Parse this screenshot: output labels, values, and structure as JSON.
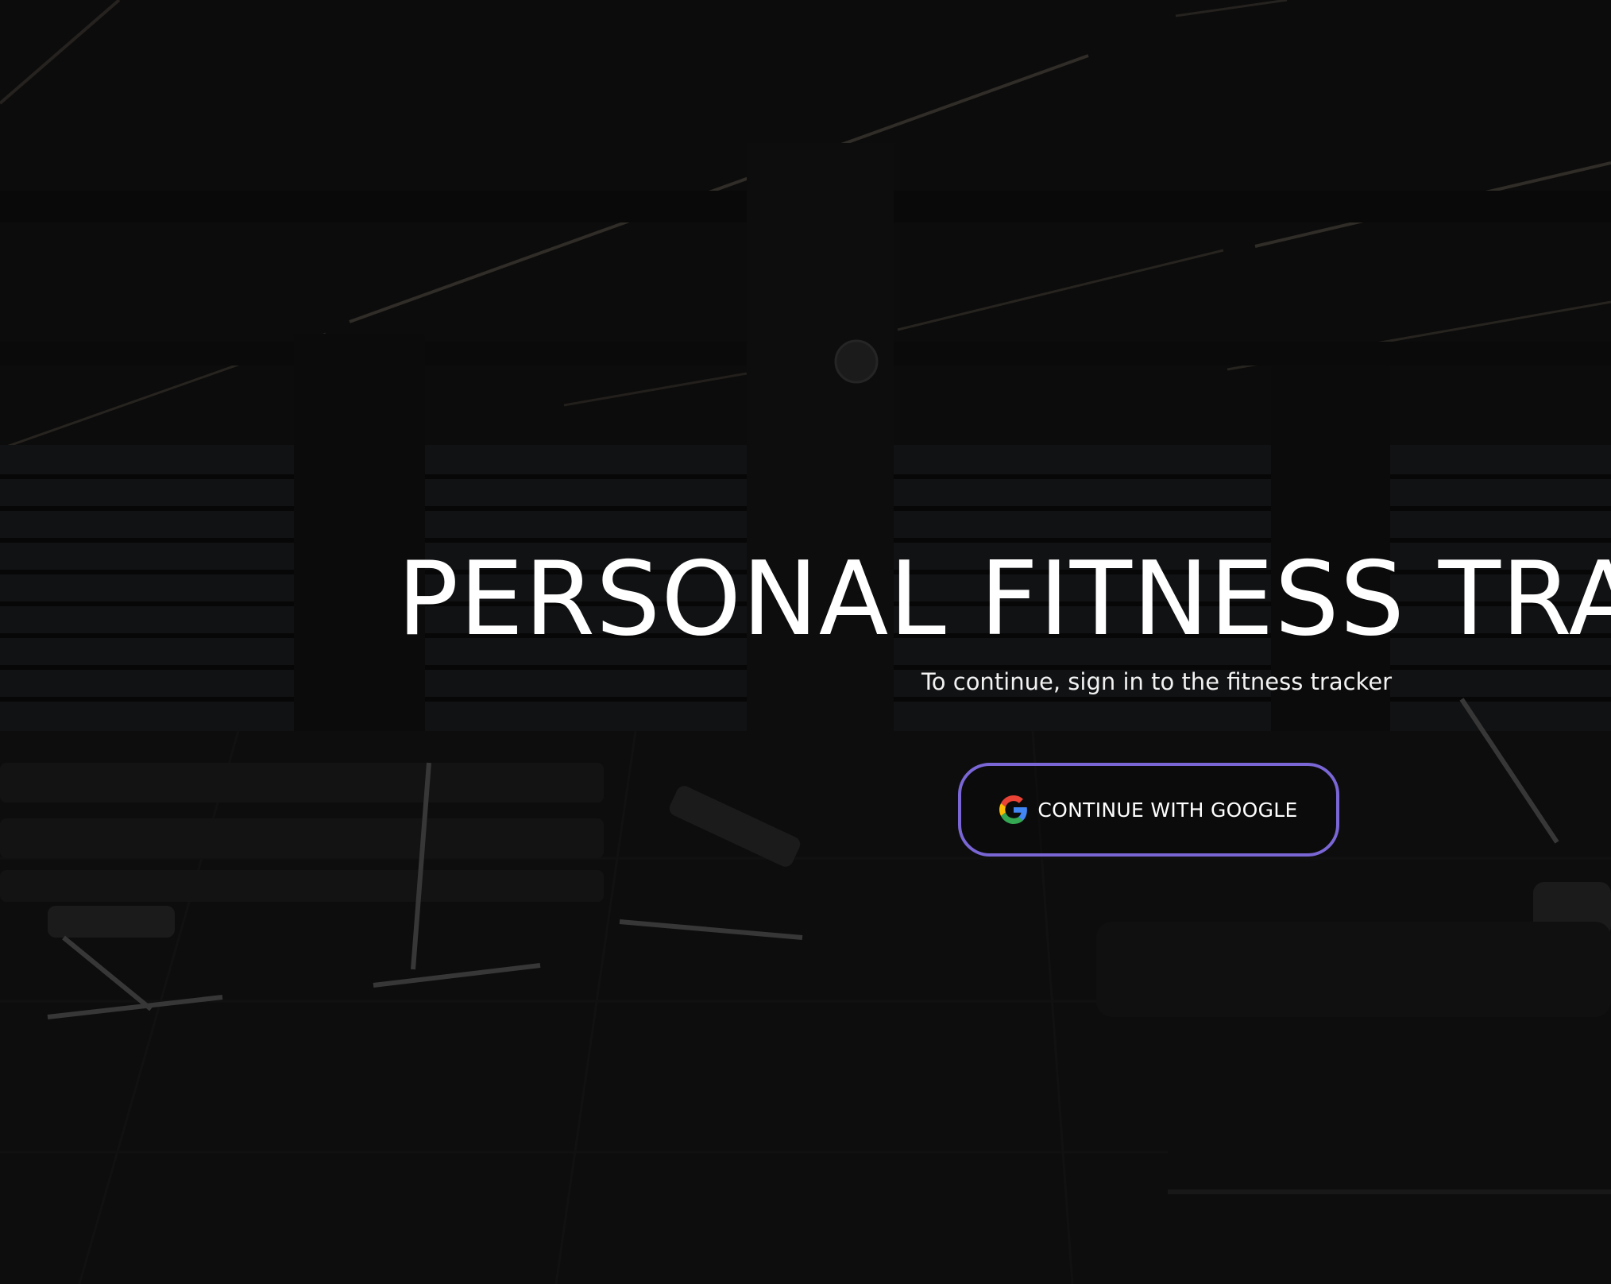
{
  "hero": {
    "title": "PERSONAL FITNESS TRA",
    "subtitle": "To continue, sign in to the fitness tracker"
  },
  "auth": {
    "google_button_label": "CONTINUE WITH GOOGLE",
    "google_icon": "google-g-icon"
  },
  "colors": {
    "background": "#0d0d0d",
    "text": "#ffffff",
    "button_border": "#7b66d6"
  }
}
